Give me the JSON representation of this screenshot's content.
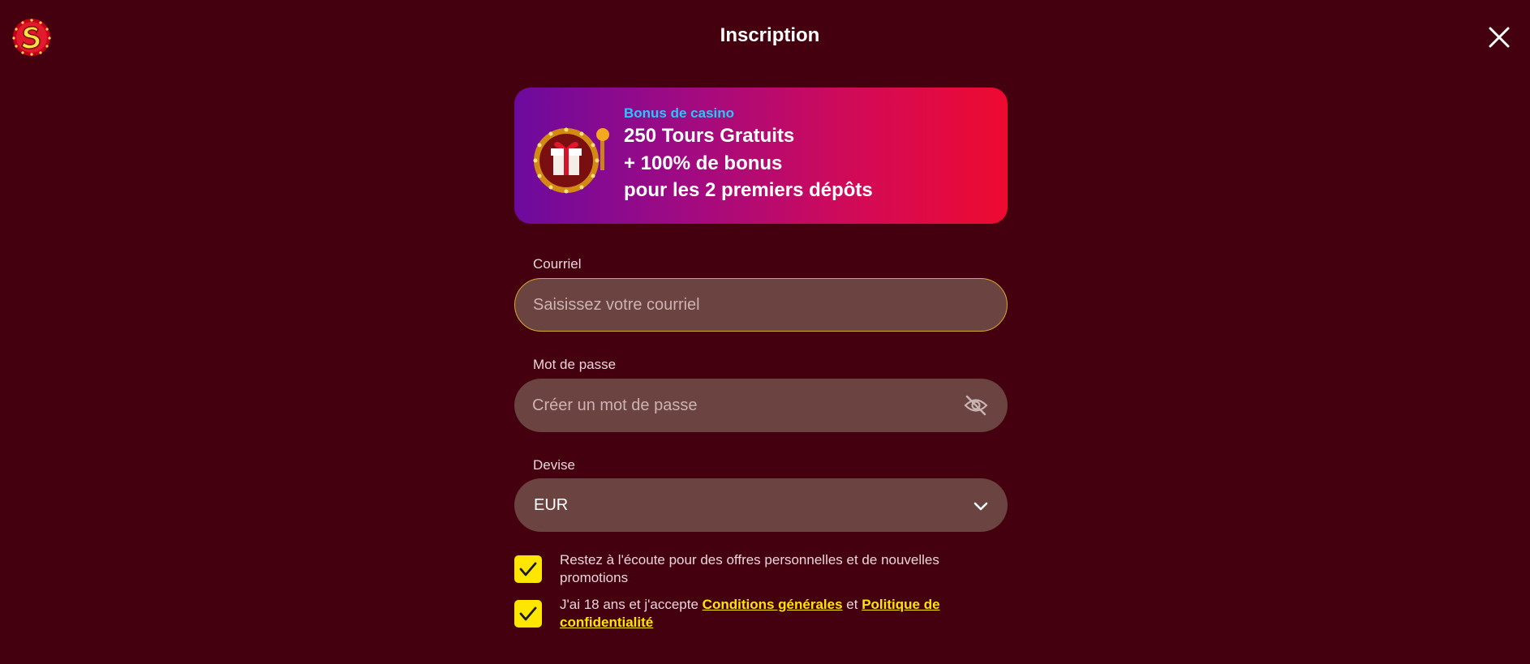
{
  "header": {
    "title": "Inscription",
    "close_icon": "close-icon",
    "logo_icon": "casino-logo-icon"
  },
  "bonus": {
    "tag": "Bonus de casino",
    "line1": "250 Tours Gratuits",
    "line2": "+ 100% de bonus",
    "line3": "pour les 2 premiers dépôts",
    "icon": "gift-slot-machine-icon",
    "gradient": [
      "#6c0a9e",
      "#ee0a30"
    ]
  },
  "form": {
    "email": {
      "label": "Courriel",
      "placeholder": "Saisissez votre courriel",
      "value": ""
    },
    "password": {
      "label": "Mot de passe",
      "placeholder": "Créer un mot de passe",
      "value": "",
      "toggle_icon": "eye-off-icon"
    },
    "currency": {
      "label": "Devise",
      "value": "EUR",
      "icon": "chevron-down-icon"
    }
  },
  "consents": {
    "offers": {
      "checked": true,
      "text": "Restez à l'écoute pour des offres personnelles et de nouvelles promotions"
    },
    "terms": {
      "checked": true,
      "prefix": "J'ai 18 ans et j'accepte",
      "link1": "Conditions générales",
      "mid": "et",
      "link2": "Politique de confidentialité"
    }
  },
  "colors": {
    "background": "#45000f",
    "field": "#6b4441",
    "accent": "#ffe600",
    "focus_border": "#d6a72c",
    "tag": "#26c6ff"
  }
}
